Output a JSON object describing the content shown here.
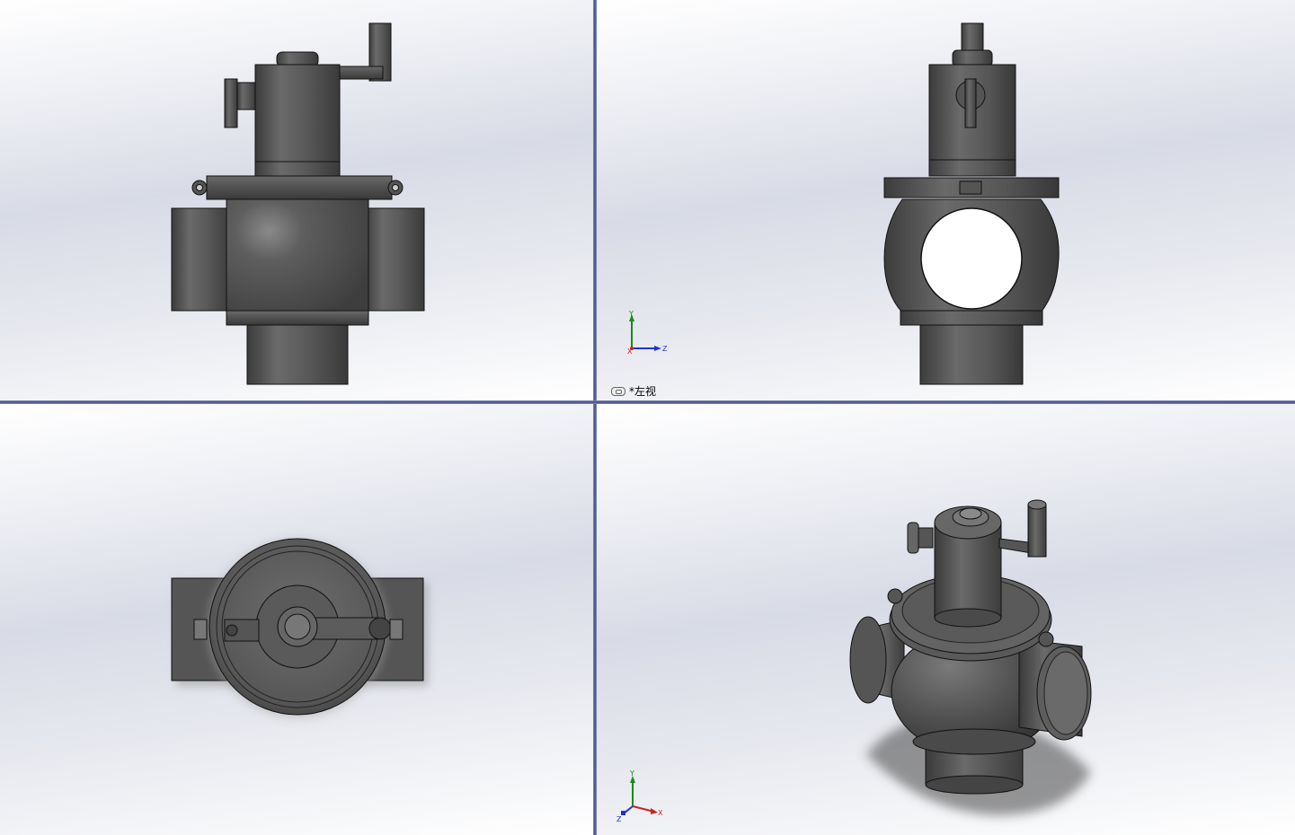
{
  "viewports": {
    "top_left": {
      "view": "front"
    },
    "top_right": {
      "view": "left",
      "label": "*左视",
      "triad": {
        "up": "Y",
        "right": "Z",
        "origin": "X"
      }
    },
    "bottom_left": {
      "view": "top"
    },
    "bottom_right": {
      "view": "isometric",
      "triad": {
        "up": "Y",
        "right": "X",
        "origin": "Z"
      }
    }
  },
  "colors": {
    "background_light": "#ffffff",
    "background_mid": "#d8dbe6",
    "viewport_divider": "#3e4b86",
    "model_metal": "#5a5a5a",
    "model_edge": "#1a1a1a",
    "axis_y": "#1a8a1a",
    "axis_z": "#2233cc",
    "axis_x": "#cc2222"
  },
  "icons": [
    "link-icon"
  ]
}
